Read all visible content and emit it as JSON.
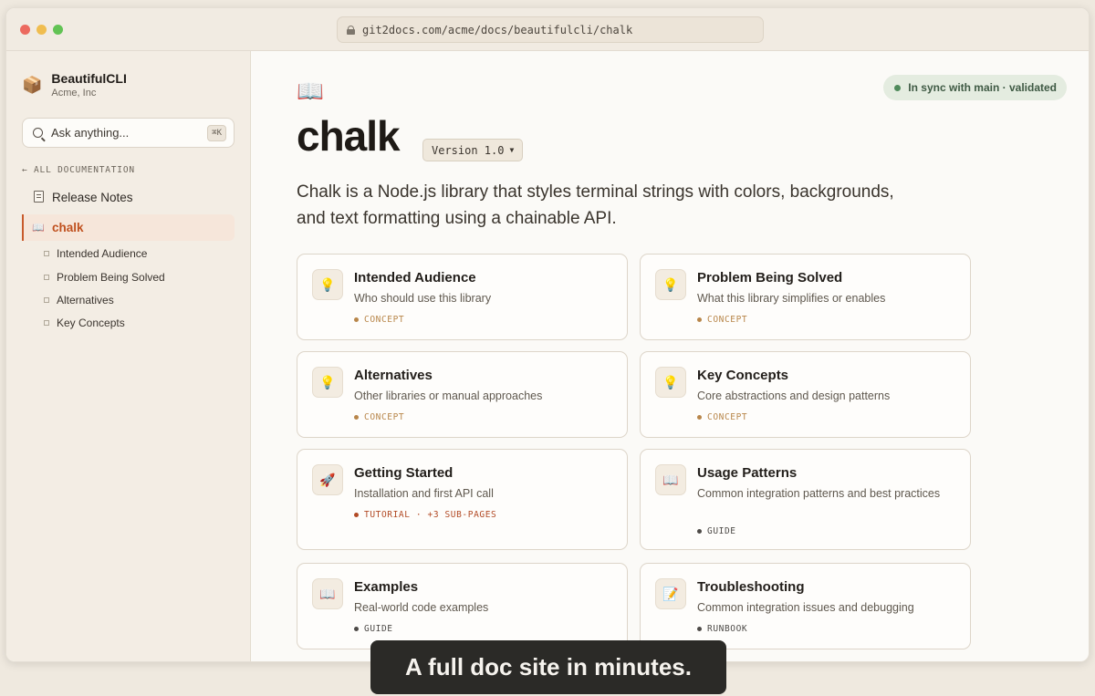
{
  "browser": {
    "url": "git2docs.com/acme/docs/beautifulcli/chalk"
  },
  "sidebar": {
    "brand": {
      "name": "BeautifulCLI",
      "org": "Acme, Inc",
      "icon": "package-icon"
    },
    "search": {
      "placeholder": "Ask anything...",
      "shortcut": "⌘K"
    },
    "section_label": "← ALL DOCUMENTATION",
    "items": [
      {
        "label": "Release Notes",
        "icon": "page-icon"
      },
      {
        "label": "chalk",
        "icon": "book-icon",
        "active": true
      }
    ],
    "sub_items": [
      "Intended Audience",
      "Problem Being Solved",
      "Alternatives",
      "Key Concepts"
    ]
  },
  "main": {
    "icon": "📖",
    "title": "chalk",
    "version": "Version 1.0",
    "sync_status": "In sync with main · validated",
    "description": "Chalk is a Node.js library that styles terminal strings with colors, backgrounds, and text formatting using a chainable API.",
    "cards": [
      {
        "icon": "💡",
        "title": "Intended Audience",
        "subtitle": "Who should use this library",
        "tag": "CONCEPT",
        "tag_color": "#b8864a"
      },
      {
        "icon": "💡",
        "title": "Problem Being Solved",
        "subtitle": "What this library simplifies or enables",
        "tag": "CONCEPT",
        "tag_color": "#b8864a"
      },
      {
        "icon": "💡",
        "title": "Alternatives",
        "subtitle": "Other libraries or manual approaches",
        "tag": "CONCEPT",
        "tag_color": "#b8864a"
      },
      {
        "icon": "💡",
        "title": "Key Concepts",
        "subtitle": "Core abstractions and design patterns",
        "tag": "CONCEPT",
        "tag_color": "#b8864a"
      },
      {
        "icon": "🚀",
        "title": "Getting Started",
        "subtitle": "Installation and first API call",
        "tag": "TUTORIAL · +3 SUB-PAGES",
        "tag_color": "#b24a25"
      },
      {
        "icon": "📖",
        "title": "Usage Patterns",
        "subtitle": "Common integration patterns and best practices",
        "tag": "GUIDE",
        "tag_color": "#4d4a47"
      },
      {
        "icon": "📖",
        "title": "Examples",
        "subtitle": "Real-world code examples",
        "tag": "GUIDE",
        "tag_color": "#4d4a47"
      },
      {
        "icon": "📝",
        "title": "Troubleshooting",
        "subtitle": "Common integration issues and debugging",
        "tag": "RUNBOOK",
        "tag_color": "#4d4a47"
      }
    ]
  },
  "caption": "A full doc site in minutes."
}
